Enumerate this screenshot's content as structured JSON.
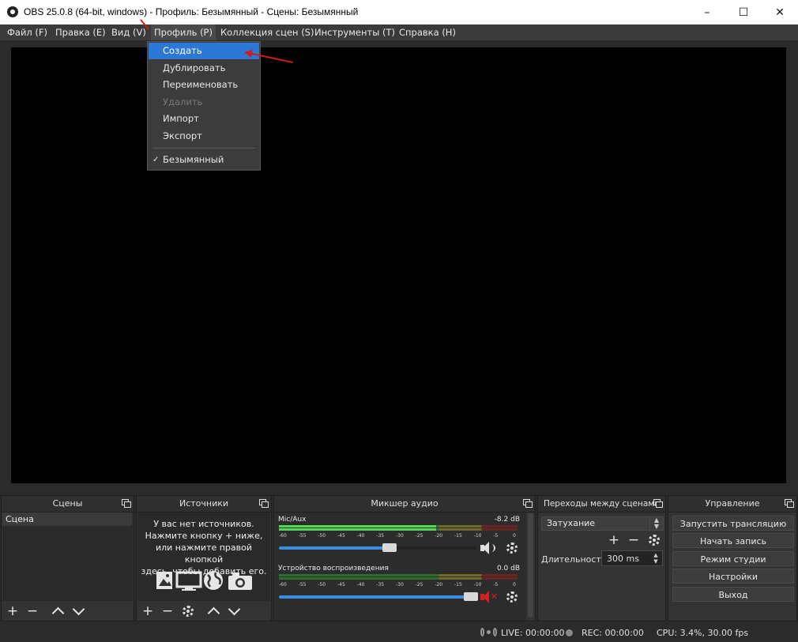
{
  "window": {
    "title": "OBS 25.0.8 (64-bit, windows) - Профиль: Безымянный - Сцены: Безымянный",
    "minimize": "–",
    "maximize": "☐",
    "close": "✕"
  },
  "menubar": {
    "items": [
      "Файл (F)",
      "Правка (E)",
      "Вид (V)",
      "Профиль (P)",
      "Коллекция сцен (S)",
      "Инструменты (T)",
      "Справка (H)"
    ]
  },
  "profile_menu": {
    "items": [
      "Создать",
      "Дублировать",
      "Переименовать",
      "Удалить",
      "Импорт",
      "Экспорт"
    ],
    "profiles": [
      "Безымянный"
    ],
    "check": "✓"
  },
  "scenes": {
    "title": "Сцены",
    "items": [
      "Сцена"
    ]
  },
  "sources": {
    "title": "Источники",
    "hint": [
      "У вас нет источников.",
      "Нажмите кнопку + ниже,",
      "или нажмите правой кнопкой",
      "здесь, чтобы добавить его."
    ]
  },
  "mixer": {
    "title": "Микшер аудио",
    "channels": [
      {
        "name": "Mic/Aux",
        "db": "-8.2 dB",
        "level": 0.66,
        "volume": 0.56,
        "muted": false
      },
      {
        "name": "Устройство воспроизведения",
        "db": "0.0 dB",
        "level": 0.0,
        "volume": 0.97,
        "muted": true
      }
    ],
    "scale": [
      "-60",
      "-55",
      "-50",
      "-45",
      "-40",
      "-35",
      "-30",
      "-25",
      "-20",
      "-15",
      "-10",
      "-5",
      "0"
    ]
  },
  "transitions": {
    "title": "Переходы между сценами",
    "selected": "Затухание",
    "duration_label": "Длительность",
    "duration_value": "300 ms"
  },
  "controls": {
    "title": "Управление",
    "buttons": [
      "Запустить трансляцию",
      "Начать запись",
      "Режим студии",
      "Настройки",
      "Выход"
    ]
  },
  "status": {
    "live": "LIVE: 00:00:00",
    "rec": "REC: 00:00:00",
    "cpu": "CPU: 3.4%, 30.00 fps"
  },
  "toolbar_glyphs": {
    "add": "+",
    "remove": "−"
  },
  "colors": {
    "accent": "#2d78d6",
    "annotation": "#d41a1a",
    "muted": "#d42020"
  }
}
